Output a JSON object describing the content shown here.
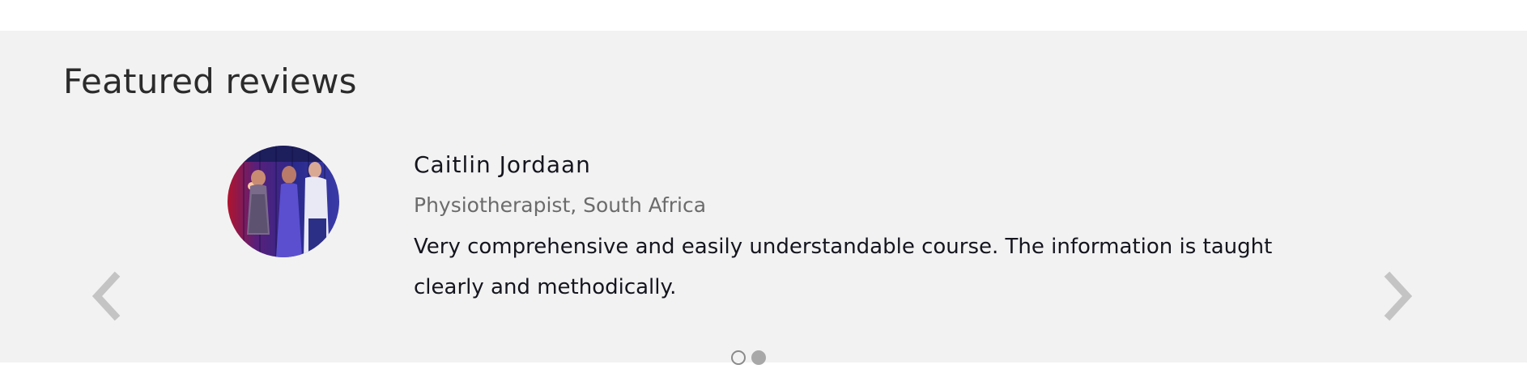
{
  "section": {
    "title": "Featured reviews"
  },
  "review": {
    "name": "Caitlin Jordaan",
    "role": "Physiotherapist, South Africa",
    "text": "Very comprehensive and easily understandable course. The information is taught clearly and methodically."
  },
  "carousel": {
    "prev_icon": "chevron-left-icon",
    "next_icon": "chevron-right-icon",
    "active_index": 1,
    "total": 2
  },
  "colors": {
    "section_background": "#f2f2f2",
    "arrow": "#c4c4c4",
    "dot_active": "#a8a8a8"
  }
}
